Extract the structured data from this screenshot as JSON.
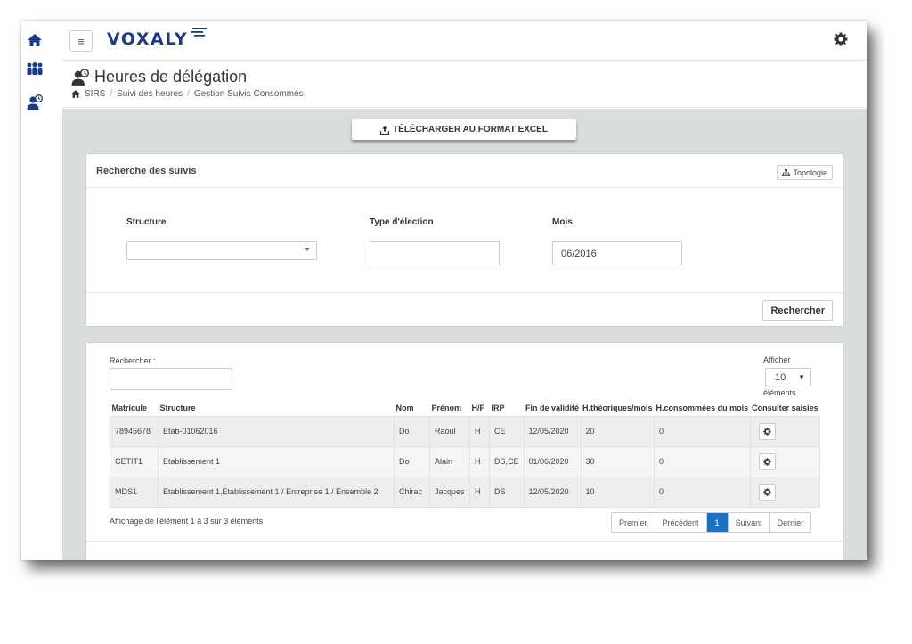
{
  "colors": {
    "brand": "#1c3a8a",
    "accent": "#1f6fbf",
    "content_bg": "#d9dddd"
  },
  "sidebar": {
    "items": [
      {
        "icon": "home-icon"
      },
      {
        "icon": "users-group-icon"
      },
      {
        "icon": "user-clock-icon"
      }
    ]
  },
  "header": {
    "menu_icon": "≡",
    "logo": "VOXALY",
    "settings_icon": "gear-icon"
  },
  "page": {
    "title": "Heures de délégation",
    "breadcrumb": [
      "SIRS",
      "Suivi des heures",
      "Gestion Suivis Consommés"
    ]
  },
  "toolbar": {
    "excel_label": "TÉLÉCHARGER AU FORMAT EXCEL"
  },
  "search_panel": {
    "title": "Recherche des suivis",
    "topology_label": "Topologie",
    "structure_label": "Structure",
    "structure_value": "",
    "election_label": "Type d'élection",
    "election_value": "",
    "month_label": "Mois",
    "month_value": "06/2016",
    "search_button": "Rechercher"
  },
  "results": {
    "search_label": "Rechercher :",
    "search_value": "",
    "show_label": "Afficher",
    "page_size": "10",
    "elements_label": "éléments",
    "columns": [
      "Matricule",
      "Structure",
      "Nom",
      "Prénom",
      "H/F",
      "IRP",
      "Fin de validité",
      "H.théoriques/mois",
      "H.consommées du mois",
      "Consulter saisies"
    ],
    "rows": [
      {
        "matricule": "78945678",
        "structure": "Etab-01062016",
        "nom": "Do",
        "prenom": "Raoul",
        "hf": "H",
        "irp": "CE",
        "fin": "12/05/2020",
        "htheo": "20",
        "hconso": "0"
      },
      {
        "matricule": "CETIT1",
        "structure": "Etablissement 1",
        "nom": "Do",
        "prenom": "Alain",
        "hf": "H",
        "irp": "DS,CE",
        "fin": "01/06/2020",
        "htheo": "30",
        "hconso": "0"
      },
      {
        "matricule": "MDS1",
        "structure": "Etablissement 1,Etablissement 1 / Entreprise 1 / Ensemble 2",
        "nom": "Chirac",
        "prenom": "Jacques",
        "hf": "H",
        "irp": "DS",
        "fin": "12/05/2020",
        "htheo": "10",
        "hconso": "0"
      }
    ],
    "info": "Affichage de l'élément 1 à 3 sur 3 éléments",
    "pager": {
      "first": "Premier",
      "prev": "Précédent",
      "current": "1",
      "next": "Suivant",
      "last": "Dernier"
    }
  }
}
